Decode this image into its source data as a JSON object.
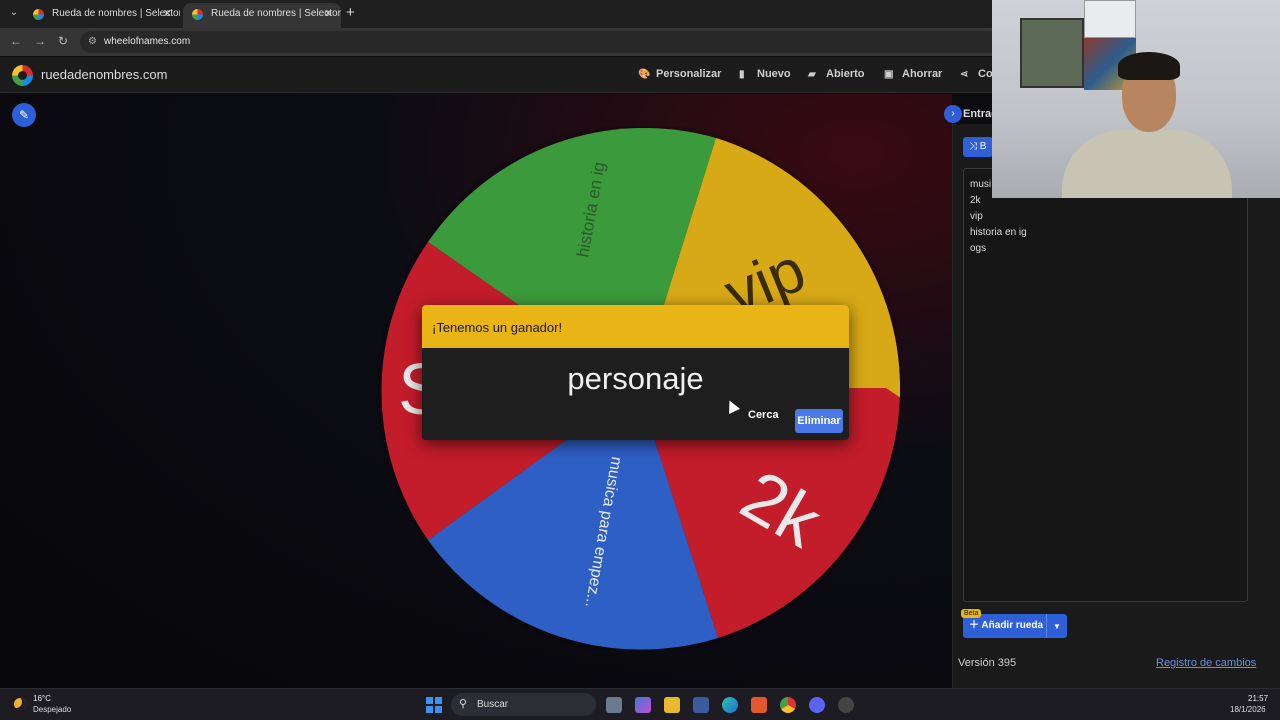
{
  "browser": {
    "tabs": [
      {
        "title": "Rueda de nombres | Selector d"
      },
      {
        "title": "Rueda de nombres | Selector d"
      }
    ],
    "url": "wheelofnames.com"
  },
  "site": {
    "brand": "ruedadenombres.com",
    "menu": {
      "customize": "Personalizar",
      "new": "Nuevo",
      "open": "Abierto",
      "save": "Ahorrar",
      "share": "Co"
    }
  },
  "wheel": {
    "segments": [
      {
        "label": "historia en ig",
        "color": "#3a9a3a"
      },
      {
        "label": "vip",
        "color": "#d8a914"
      },
      {
        "label": "2k",
        "color": "#c31f2c"
      },
      {
        "label": "musica para empez...",
        "color": "#2d5ec4"
      },
      {
        "label": "S",
        "color": "#c31f2c"
      }
    ]
  },
  "dialog": {
    "title": "¡Tenemos un ganador!",
    "winner": "personaje",
    "close_label": "Cerca",
    "remove_label": "Eliminar"
  },
  "panel": {
    "tab_label": "Entrad",
    "shuffle_label": "B",
    "entries": [
      "musi",
      "2k",
      "vip",
      "historia en ig",
      "ogs"
    ],
    "beta_badge": "Beta",
    "add_wheel_label": "Añadir rueda",
    "version": "Versión 395",
    "changelog_label": "Registro de cambios"
  },
  "taskbar": {
    "temperature": "16°C",
    "condition": "Despejado",
    "search_placeholder": "Buscar",
    "time": "21:57",
    "date": "18/1/2026"
  }
}
